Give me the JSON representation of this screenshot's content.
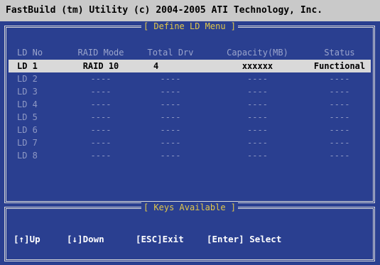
{
  "app": {
    "title": "FastBuild (tm) Utility (c) 2004-2005 ATI Technology, Inc."
  },
  "define_ld_menu": {
    "title": "[ Define LD Menu ]",
    "columns": [
      "LD No",
      "RAID Mode",
      "Total Drv",
      "Capacity(MB)",
      "Status"
    ],
    "rows": [
      {
        "ld": "LD 1",
        "mode": "RAID 10",
        "drives": "4",
        "capacity": "xxxxxx",
        "status": "Functional"
      },
      {
        "ld": "LD 2",
        "mode": "----",
        "drives": "----",
        "capacity": "----",
        "status": "----"
      },
      {
        "ld": "LD 3",
        "mode": "----",
        "drives": "----",
        "capacity": "----",
        "status": "----"
      },
      {
        "ld": "LD 4",
        "mode": "----",
        "drives": "----",
        "capacity": "----",
        "status": "----"
      },
      {
        "ld": "LD 5",
        "mode": "----",
        "drives": "----",
        "capacity": "----",
        "status": "----"
      },
      {
        "ld": "LD 6",
        "mode": "----",
        "drives": "----",
        "capacity": "----",
        "status": "----"
      },
      {
        "ld": "LD 7",
        "mode": "----",
        "drives": "----",
        "capacity": "----",
        "status": "----"
      },
      {
        "ld": "LD 8",
        "mode": "----",
        "drives": "----",
        "capacity": "----",
        "status": "----"
      }
    ]
  },
  "keys_available": {
    "title": "[ Keys Available ]",
    "keys": [
      "[↑]Up",
      "[↓]Down",
      "[ESC]Exit",
      "[Enter] Select"
    ]
  },
  "colors": {
    "background": "#2a3f90",
    "title_bar": "#c9c9c9",
    "panel_title": "#e0c64a",
    "selected_row": "#d9d9d9",
    "dim_text": "#8e98c4"
  }
}
